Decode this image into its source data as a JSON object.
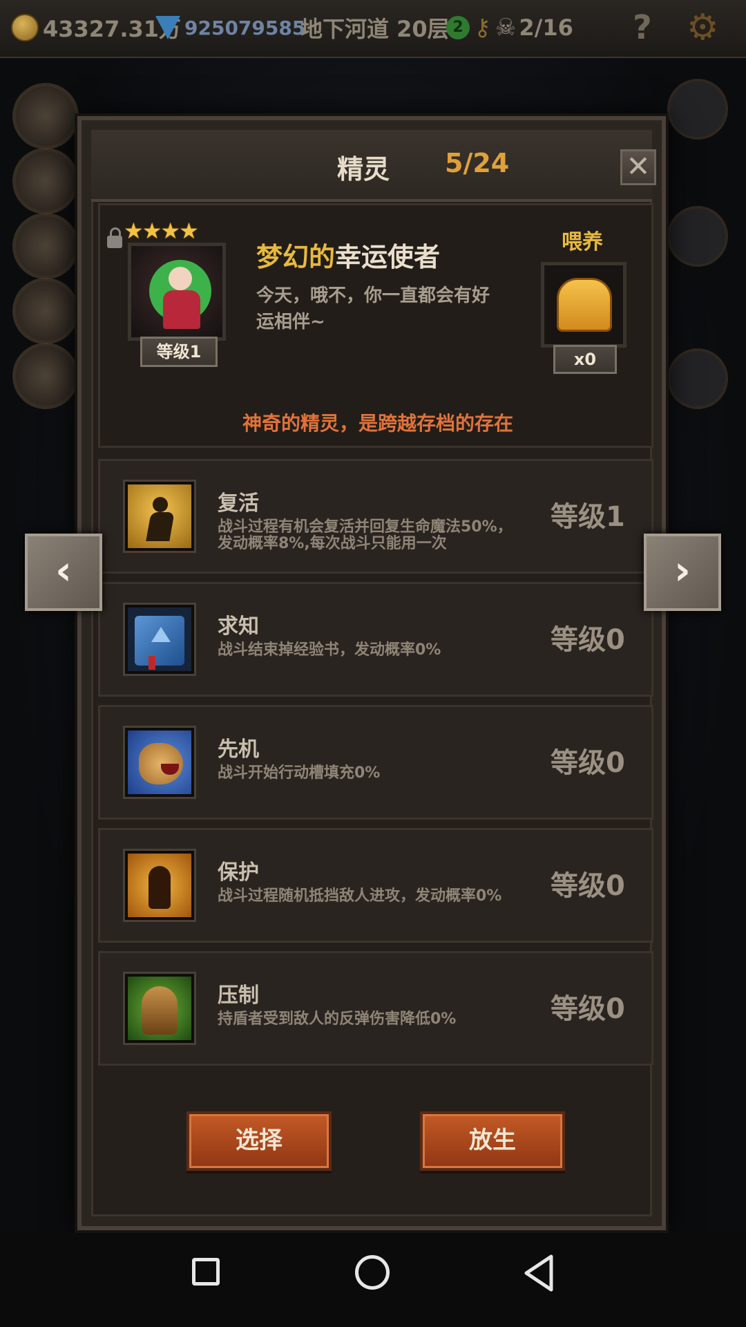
{
  "topbar": {
    "gold": "43327.31万",
    "gems": "925079585",
    "location": "地下河道 20层",
    "keys_badge": "2",
    "skull_count": "2/16",
    "help": "?"
  },
  "panel": {
    "title": "精灵",
    "count": "5/24",
    "close": "✕"
  },
  "spirit": {
    "stars": "★★★★",
    "level_tag": "等级1",
    "name_part1": "梦幻的",
    "name_part2": "幸运使者",
    "description": "今天，哦不，你一直都会有好运相伴~",
    "feed_label": "喂养",
    "bread_count": "x0",
    "note": "神奇的精灵，是跨越存档的存在"
  },
  "skills": [
    {
      "name": "复活",
      "desc": "战斗过程有机会复活并回复生命魔法50%，发动概率8%,每次战斗只能用一次",
      "level": "等级1",
      "icon": "revive-icon"
    },
    {
      "name": "求知",
      "desc": "战斗结束掉经验书，发动概率0%",
      "level": "等级0",
      "icon": "book-icon"
    },
    {
      "name": "先机",
      "desc": "战斗开始行动槽填充0%",
      "level": "等级0",
      "icon": "leopard-icon"
    },
    {
      "name": "保护",
      "desc": "战斗过程随机抵挡敌人进攻，发动概率0%",
      "level": "等级0",
      "icon": "protect-icon"
    },
    {
      "name": "压制",
      "desc": "持盾者受到敌人的反弹伤害降低0%",
      "level": "等级0",
      "icon": "suppress-icon"
    }
  ],
  "actions": {
    "select": "选择",
    "release": "放生"
  },
  "nav": {
    "prev": "‹",
    "next": "›"
  },
  "colors": {
    "accent_gold": "#e7b93e",
    "note_orange": "#e0733a",
    "button_red": "#b24a1f"
  }
}
